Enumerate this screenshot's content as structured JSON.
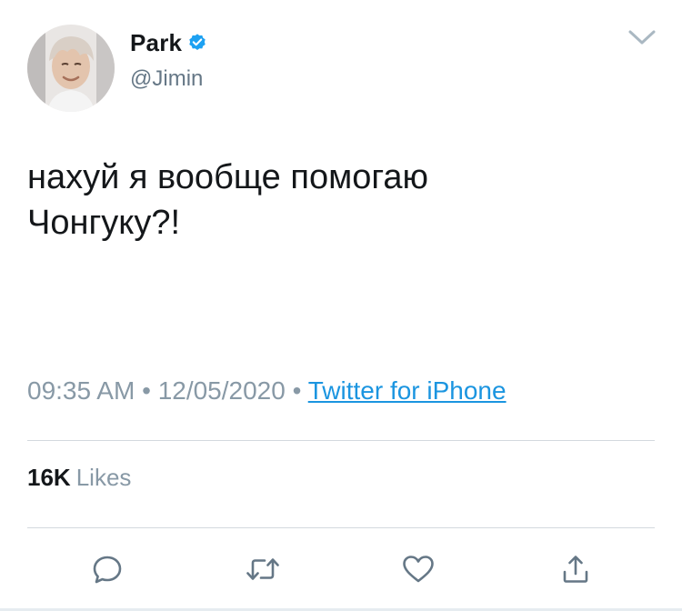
{
  "author": {
    "display_name": "Park",
    "handle": "@Jimin",
    "verified": true,
    "avatar_icon": "profile-photo"
  },
  "tweet": {
    "text": "нахуй я вообще помогаю\nЧонгуку?!"
  },
  "meta": {
    "time": "09:35 AM",
    "separator": "•",
    "date": "12/05/2020",
    "source": "Twitter for iPhone"
  },
  "stats": {
    "likes_count": "16K",
    "likes_label": "Likes"
  },
  "actions": [
    {
      "name": "reply",
      "icon": "reply-icon"
    },
    {
      "name": "retweet",
      "icon": "retweet-icon"
    },
    {
      "name": "like",
      "icon": "heart-icon"
    },
    {
      "name": "share",
      "icon": "share-icon"
    }
  ],
  "colors": {
    "text_primary": "#14171a",
    "text_secondary": "#657786",
    "text_meta": "#8899a6",
    "link": "#1b95e0",
    "verified": "#1da1f2",
    "divider": "#d3d9de",
    "icon": "#657786"
  }
}
